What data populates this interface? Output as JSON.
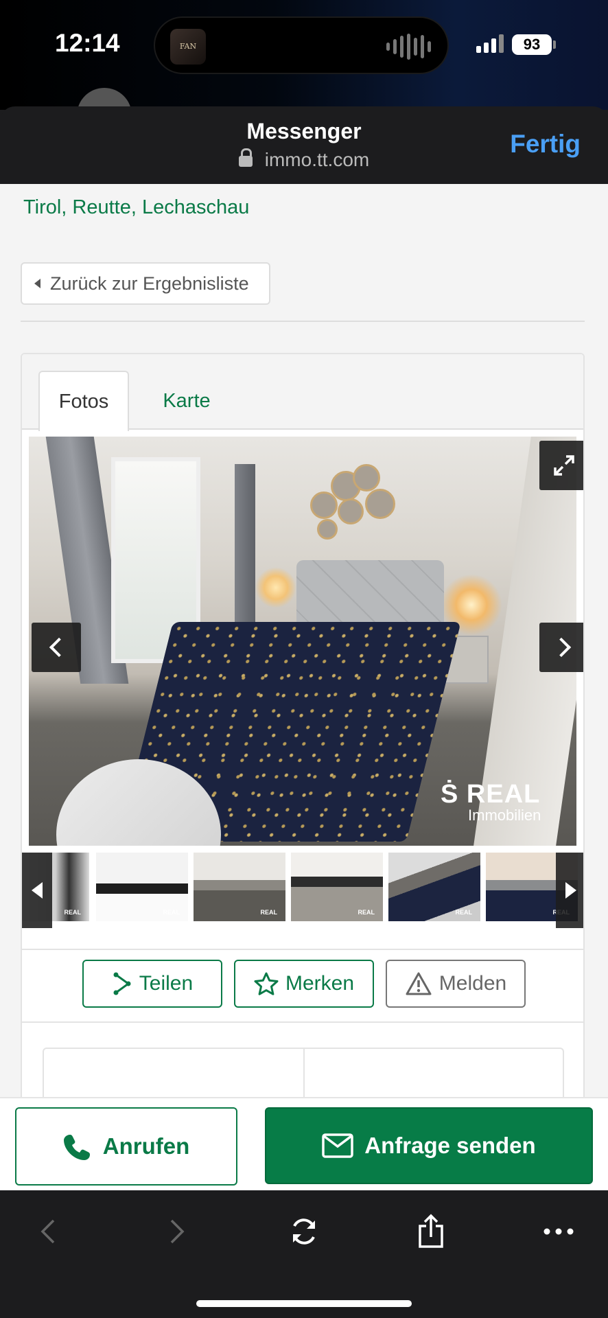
{
  "status_bar": {
    "time": "12:14",
    "battery": "93",
    "now_playing_art_text": "FAN"
  },
  "browser": {
    "title": "Messenger",
    "url": "immo.tt.com",
    "done_label": "Fertig",
    "lock_icon": "lock-icon"
  },
  "listing": {
    "location": "Tirol, Reutte, Lechaschau",
    "back_link": "Zurück zur Ergebnisliste",
    "tabs": [
      {
        "label": "Fotos",
        "active": true
      },
      {
        "label": "Karte",
        "active": false
      }
    ],
    "photo": {
      "watermark_main": "REAL",
      "watermark_sub": "Immobilien"
    },
    "thumbnails_count": 6,
    "actions": {
      "share": "Teilen",
      "save": "Merken",
      "report": "Melden"
    }
  },
  "cta": {
    "call": "Anrufen",
    "send": "Anfrage senden"
  },
  "toolbar": {
    "icons": [
      "back-icon",
      "forward-icon",
      "reload-icon",
      "share-icon",
      "more-icon"
    ]
  },
  "colors": {
    "brand_green": "#0a7a47",
    "link_blue": "#4a9ff5",
    "toolbar_bg": "#1c1c1e"
  }
}
